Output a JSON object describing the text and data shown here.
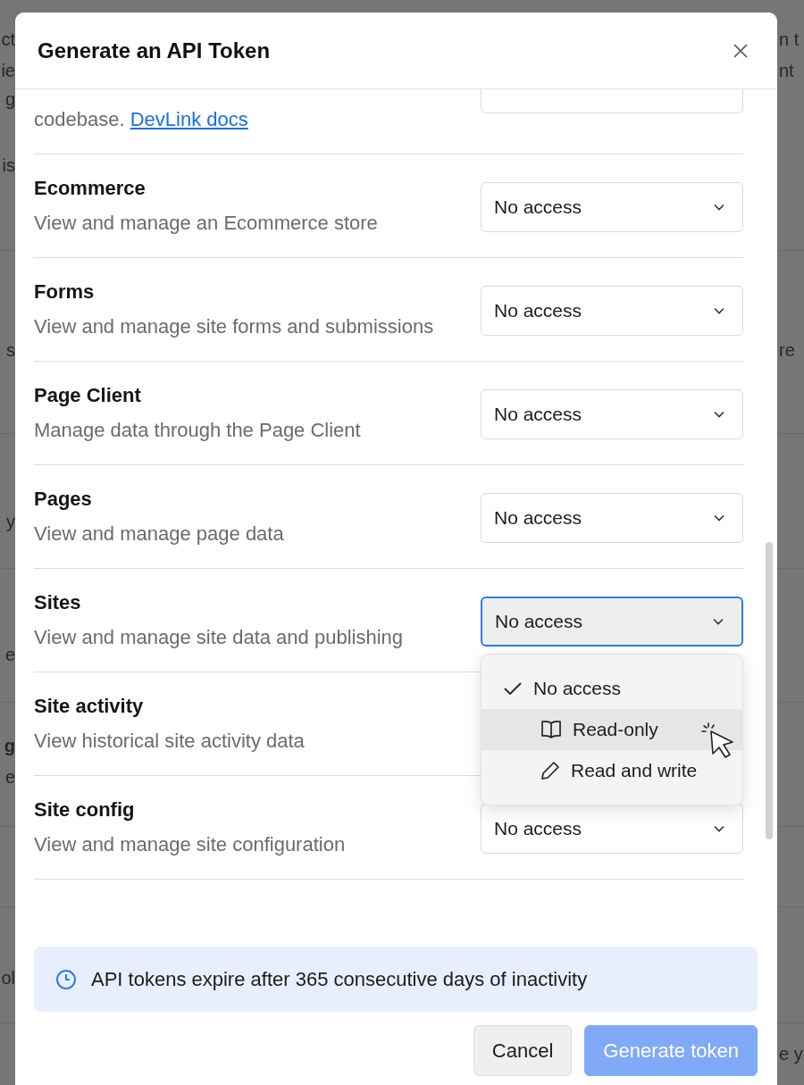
{
  "background_page": {
    "fragments": [
      {
        "left": "ct",
        "right": "n t"
      },
      {
        "left": "ie",
        "right": "nt"
      },
      {
        "left": "g"
      },
      {
        "left": "is"
      },
      {
        "left": "s",
        "right": "re"
      },
      {
        "left": "y"
      },
      {
        "left": "e"
      },
      {
        "left": "g",
        "bold": true
      },
      {
        "left": "e"
      },
      {
        "left": "ol"
      },
      {
        "right": "e y"
      }
    ]
  },
  "dialog": {
    "title": "Generate an API Token",
    "permissions": [
      {
        "description": "codebase.",
        "link": "DevLink docs",
        "control": true
      },
      {
        "name": "Ecommerce",
        "description": "View and manage an Ecommerce store",
        "value": "No access",
        "focused": false
      },
      {
        "name": "Forms",
        "description": "View and manage site forms and submissions",
        "value": "No access",
        "focused": false
      },
      {
        "name": "Page Client",
        "description": "Manage data through the Page Client",
        "value": "No access",
        "focused": false
      },
      {
        "name": "Pages",
        "description": "View and manage page data",
        "value": "No access",
        "focused": false
      },
      {
        "name": "Sites",
        "description": "View and manage site data and publishing",
        "value": "No access",
        "focused": true,
        "menu": [
          {
            "label": "No access",
            "kind": "check",
            "selected": true,
            "highlighted": false
          },
          {
            "label": "Read-only",
            "kind": "book",
            "selected": false,
            "highlighted": true
          },
          {
            "label": "Read and write",
            "kind": "pencil",
            "selected": false,
            "highlighted": false
          }
        ]
      },
      {
        "name": "Site activity",
        "description": "View historical site activity data",
        "control": false
      },
      {
        "name": "Site config",
        "description": "View and manage site configuration",
        "value": "No access",
        "focused": false
      }
    ],
    "notice": "API tokens expire after 365 consecutive days of inactivity",
    "buttons": [
      {
        "label": "Cancel",
        "kind": "secondary"
      },
      {
        "label": "Generate token",
        "kind": "primary"
      }
    ]
  }
}
